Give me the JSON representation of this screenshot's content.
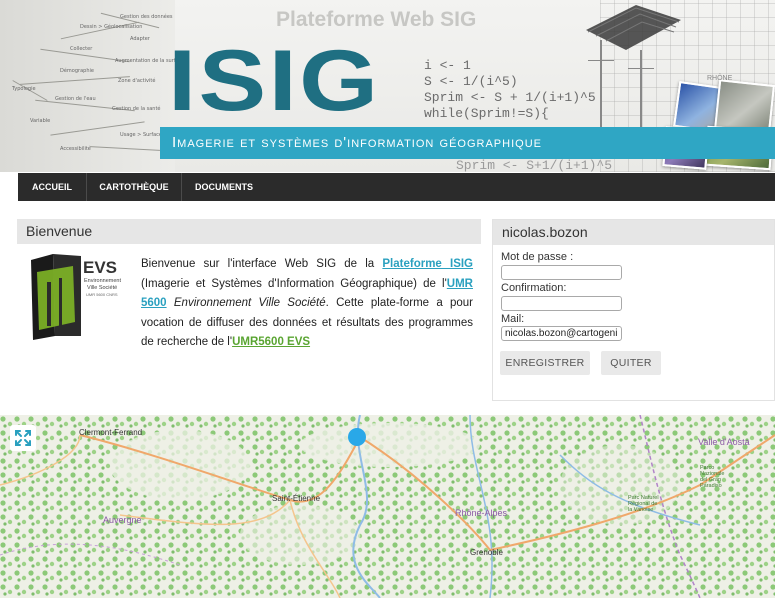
{
  "banner": {
    "top_title": "Plateforme Web SIG",
    "logo_text": "ISIG",
    "subtitle": "Imagerie et systèmes d'information géographique",
    "code_lines": [
      "i <- 1",
      "S <- 1/(i^5)",
      "Sprim <- S + 1/(i+1)^5",
      "while(Sprim!=S){"
    ],
    "code_bottom": "Sprim <- S+1/(i+1)^5",
    "photo_label": "RHÔNE",
    "mindmap_nodes": [
      "Gestion des données",
      "Dessin > Géolocalisation",
      "Adapter",
      "Collecter",
      "Augmentation de la surface",
      "Démographie",
      "Zone d'activité",
      "Typologie",
      "Gestion de l'eau",
      "Gestion de la santé",
      "Variable",
      "Usage > Surface",
      "Accessibilité"
    ]
  },
  "nav": {
    "items": [
      "ACCUEIL",
      "CARTOTHÈQUE",
      "DOCUMENTS"
    ]
  },
  "welcome": {
    "heading": "Bienvenue",
    "p1": "Bienvenue sur l'interface Web SIG de la ",
    "link1": "Plateforme ISIG",
    "p2": " (Imagerie et Systèmes d'Information Géographique) de l'",
    "link2": "UMR 5600",
    "p3": " ",
    "em": "Environnement Ville Société",
    "p4": ". Cette plate-forme a pour vocation de diffuser des données et résultats des programmes de recherche de l'",
    "link3": "UMR5600 EVS",
    "logo": {
      "acronym": "EVS",
      "line1": "Environnement",
      "line2": "Ville Société",
      "line3": "UMR 5600 CNRS"
    }
  },
  "account": {
    "heading": "nicolas.bozon",
    "password_label": "Mot de passe :",
    "confirm_label": "Confirmation:",
    "mail_label": "Mail:",
    "password_value": "",
    "confirm_value": "",
    "mail_value": "nicolas.bozon@cartogeni",
    "save_button": "ENREGISTRER",
    "quit_button": "QUITER"
  },
  "map": {
    "labels": [
      "Clermont-Ferrand",
      "Saint-Étienne",
      "Auvergne",
      "Rhône-Alpes",
      "Grenoble",
      "Valle d'Aosta",
      "Parco Nazionale del Gran Paradiso",
      "Parc Naturel Régional de la Vanoise"
    ],
    "colors": {
      "forest": "#8cc978",
      "water": "#8fbce6",
      "road": "#f0a86b",
      "marker": "#29a8e8"
    }
  }
}
